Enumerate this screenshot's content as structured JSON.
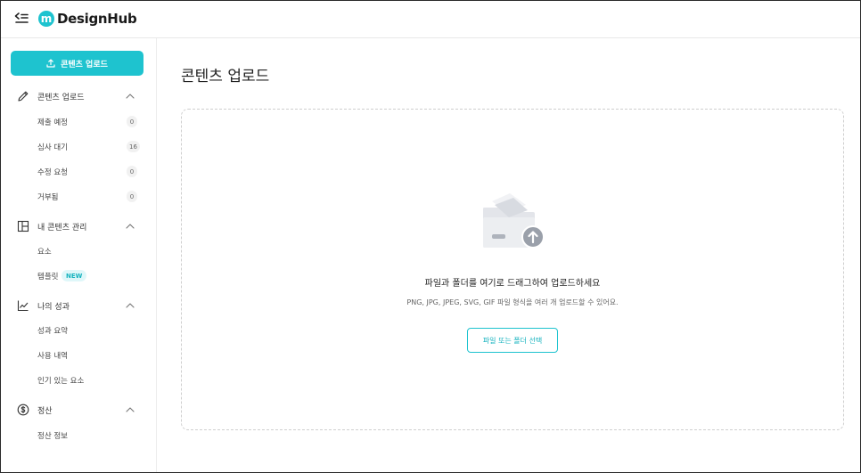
{
  "header": {
    "logo_mark": "m",
    "logo_text": "DesignHub"
  },
  "sidebar": {
    "upload_button_label": "콘텐츠 업로드",
    "sections": [
      {
        "label": "콘텐츠 업로드",
        "icon": "pencil-icon",
        "items": [
          {
            "label": "제출 예정",
            "count": "0"
          },
          {
            "label": "심사 대기",
            "count": "16"
          },
          {
            "label": "수정 요청",
            "count": "0"
          },
          {
            "label": "거부됨",
            "count": "0"
          }
        ]
      },
      {
        "label": "내 콘텐츠 관리",
        "icon": "grid-icon",
        "items": [
          {
            "label": "요소"
          },
          {
            "label": "템플릿",
            "badge": "NEW"
          }
        ]
      },
      {
        "label": "나의 성과",
        "icon": "chart-line-icon",
        "items": [
          {
            "label": "성과 요약"
          },
          {
            "label": "사용 내역"
          },
          {
            "label": "인기 있는 요소"
          }
        ]
      },
      {
        "label": "정산",
        "icon": "dollar-circle-icon",
        "items": [
          {
            "label": "정산 정보"
          }
        ]
      }
    ]
  },
  "main": {
    "title": "콘텐츠 업로드",
    "dropzone": {
      "title": "파일과 폴더를 여기로 드래그하여 업로드하세요",
      "subtitle": "PNG, JPG, JPEG, SVG, GIF 파일 형식을 여러 개 업로드할 수 있어요.",
      "button_label": "파일 또는 폴더 선택"
    }
  },
  "colors": {
    "accent": "#1ec3cf",
    "border": "#cfcfcf"
  }
}
